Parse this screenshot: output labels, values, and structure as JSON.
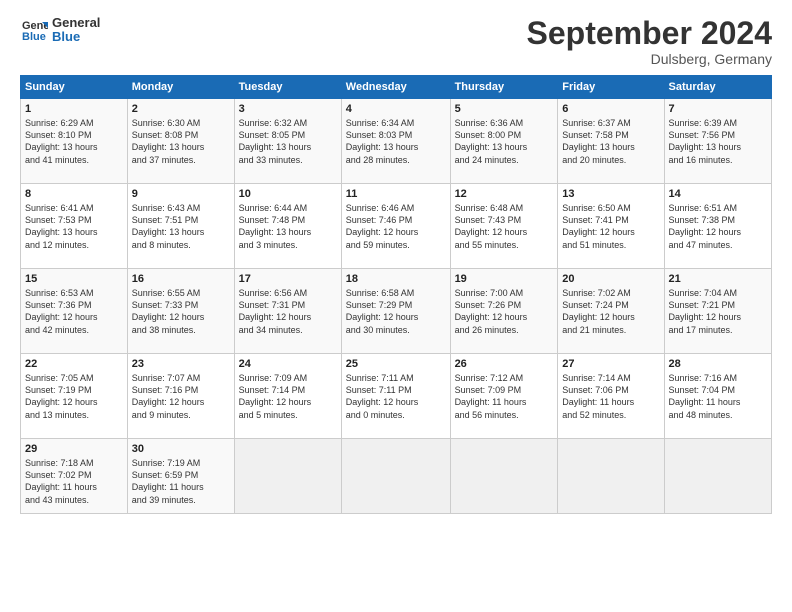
{
  "header": {
    "logo_line1": "General",
    "logo_line2": "Blue",
    "month_title": "September 2024",
    "location": "Dulsberg, Germany"
  },
  "days_of_week": [
    "Sunday",
    "Monday",
    "Tuesday",
    "Wednesday",
    "Thursday",
    "Friday",
    "Saturday"
  ],
  "weeks": [
    [
      {
        "day": 1,
        "lines": [
          "Sunrise: 6:29 AM",
          "Sunset: 8:10 PM",
          "Daylight: 13 hours",
          "and 41 minutes."
        ]
      },
      {
        "day": 2,
        "lines": [
          "Sunrise: 6:30 AM",
          "Sunset: 8:08 PM",
          "Daylight: 13 hours",
          "and 37 minutes."
        ]
      },
      {
        "day": 3,
        "lines": [
          "Sunrise: 6:32 AM",
          "Sunset: 8:05 PM",
          "Daylight: 13 hours",
          "and 33 minutes."
        ]
      },
      {
        "day": 4,
        "lines": [
          "Sunrise: 6:34 AM",
          "Sunset: 8:03 PM",
          "Daylight: 13 hours",
          "and 28 minutes."
        ]
      },
      {
        "day": 5,
        "lines": [
          "Sunrise: 6:36 AM",
          "Sunset: 8:00 PM",
          "Daylight: 13 hours",
          "and 24 minutes."
        ]
      },
      {
        "day": 6,
        "lines": [
          "Sunrise: 6:37 AM",
          "Sunset: 7:58 PM",
          "Daylight: 13 hours",
          "and 20 minutes."
        ]
      },
      {
        "day": 7,
        "lines": [
          "Sunrise: 6:39 AM",
          "Sunset: 7:56 PM",
          "Daylight: 13 hours",
          "and 16 minutes."
        ]
      }
    ],
    [
      {
        "day": 8,
        "lines": [
          "Sunrise: 6:41 AM",
          "Sunset: 7:53 PM",
          "Daylight: 13 hours",
          "and 12 minutes."
        ]
      },
      {
        "day": 9,
        "lines": [
          "Sunrise: 6:43 AM",
          "Sunset: 7:51 PM",
          "Daylight: 13 hours",
          "and 8 minutes."
        ]
      },
      {
        "day": 10,
        "lines": [
          "Sunrise: 6:44 AM",
          "Sunset: 7:48 PM",
          "Daylight: 13 hours",
          "and 3 minutes."
        ]
      },
      {
        "day": 11,
        "lines": [
          "Sunrise: 6:46 AM",
          "Sunset: 7:46 PM",
          "Daylight: 12 hours",
          "and 59 minutes."
        ]
      },
      {
        "day": 12,
        "lines": [
          "Sunrise: 6:48 AM",
          "Sunset: 7:43 PM",
          "Daylight: 12 hours",
          "and 55 minutes."
        ]
      },
      {
        "day": 13,
        "lines": [
          "Sunrise: 6:50 AM",
          "Sunset: 7:41 PM",
          "Daylight: 12 hours",
          "and 51 minutes."
        ]
      },
      {
        "day": 14,
        "lines": [
          "Sunrise: 6:51 AM",
          "Sunset: 7:38 PM",
          "Daylight: 12 hours",
          "and 47 minutes."
        ]
      }
    ],
    [
      {
        "day": 15,
        "lines": [
          "Sunrise: 6:53 AM",
          "Sunset: 7:36 PM",
          "Daylight: 12 hours",
          "and 42 minutes."
        ]
      },
      {
        "day": 16,
        "lines": [
          "Sunrise: 6:55 AM",
          "Sunset: 7:33 PM",
          "Daylight: 12 hours",
          "and 38 minutes."
        ]
      },
      {
        "day": 17,
        "lines": [
          "Sunrise: 6:56 AM",
          "Sunset: 7:31 PM",
          "Daylight: 12 hours",
          "and 34 minutes."
        ]
      },
      {
        "day": 18,
        "lines": [
          "Sunrise: 6:58 AM",
          "Sunset: 7:29 PM",
          "Daylight: 12 hours",
          "and 30 minutes."
        ]
      },
      {
        "day": 19,
        "lines": [
          "Sunrise: 7:00 AM",
          "Sunset: 7:26 PM",
          "Daylight: 12 hours",
          "and 26 minutes."
        ]
      },
      {
        "day": 20,
        "lines": [
          "Sunrise: 7:02 AM",
          "Sunset: 7:24 PM",
          "Daylight: 12 hours",
          "and 21 minutes."
        ]
      },
      {
        "day": 21,
        "lines": [
          "Sunrise: 7:04 AM",
          "Sunset: 7:21 PM",
          "Daylight: 12 hours",
          "and 17 minutes."
        ]
      }
    ],
    [
      {
        "day": 22,
        "lines": [
          "Sunrise: 7:05 AM",
          "Sunset: 7:19 PM",
          "Daylight: 12 hours",
          "and 13 minutes."
        ]
      },
      {
        "day": 23,
        "lines": [
          "Sunrise: 7:07 AM",
          "Sunset: 7:16 PM",
          "Daylight: 12 hours",
          "and 9 minutes."
        ]
      },
      {
        "day": 24,
        "lines": [
          "Sunrise: 7:09 AM",
          "Sunset: 7:14 PM",
          "Daylight: 12 hours",
          "and 5 minutes."
        ]
      },
      {
        "day": 25,
        "lines": [
          "Sunrise: 7:11 AM",
          "Sunset: 7:11 PM",
          "Daylight: 12 hours",
          "and 0 minutes."
        ]
      },
      {
        "day": 26,
        "lines": [
          "Sunrise: 7:12 AM",
          "Sunset: 7:09 PM",
          "Daylight: 11 hours",
          "and 56 minutes."
        ]
      },
      {
        "day": 27,
        "lines": [
          "Sunrise: 7:14 AM",
          "Sunset: 7:06 PM",
          "Daylight: 11 hours",
          "and 52 minutes."
        ]
      },
      {
        "day": 28,
        "lines": [
          "Sunrise: 7:16 AM",
          "Sunset: 7:04 PM",
          "Daylight: 11 hours",
          "and 48 minutes."
        ]
      }
    ],
    [
      {
        "day": 29,
        "lines": [
          "Sunrise: 7:18 AM",
          "Sunset: 7:02 PM",
          "Daylight: 11 hours",
          "and 43 minutes."
        ]
      },
      {
        "day": 30,
        "lines": [
          "Sunrise: 7:19 AM",
          "Sunset: 6:59 PM",
          "Daylight: 11 hours",
          "and 39 minutes."
        ]
      },
      {
        "day": null,
        "lines": []
      },
      {
        "day": null,
        "lines": []
      },
      {
        "day": null,
        "lines": []
      },
      {
        "day": null,
        "lines": []
      },
      {
        "day": null,
        "lines": []
      }
    ]
  ]
}
